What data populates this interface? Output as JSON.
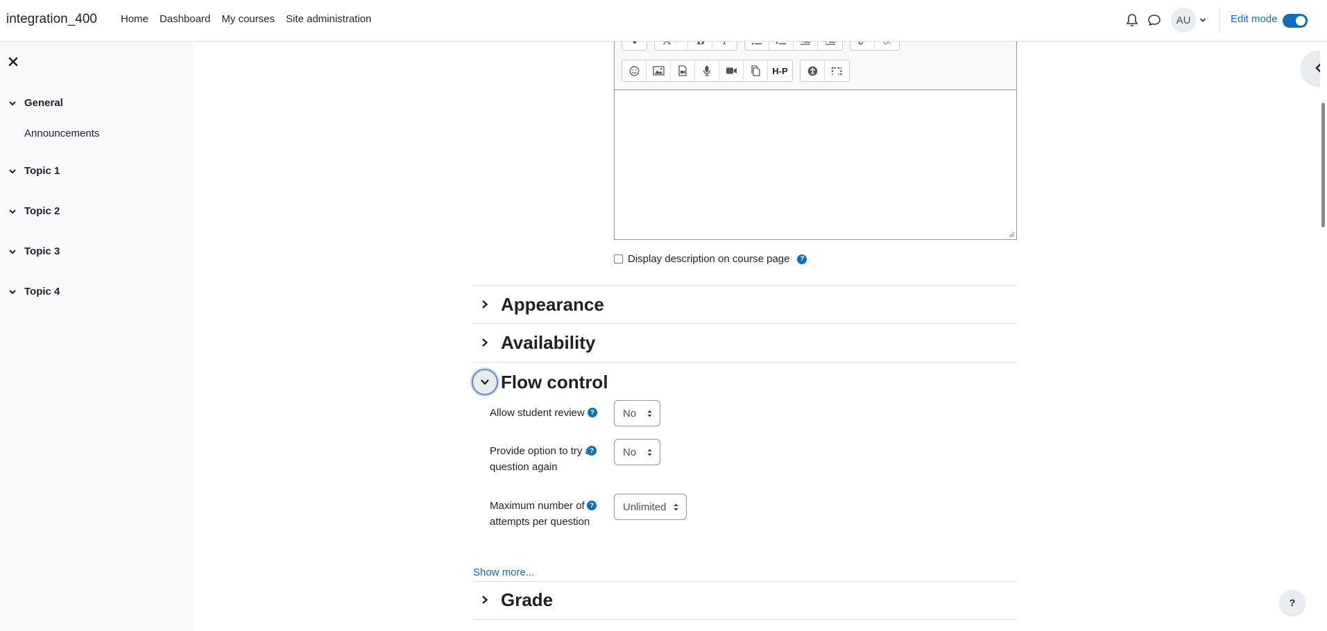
{
  "navbar": {
    "brand": "integration_400",
    "links": [
      "Home",
      "Dashboard",
      "My courses",
      "Site administration"
    ],
    "avatar_initials": "AU",
    "edit_mode_label": "Edit mode",
    "edit_mode_on": true
  },
  "drawer": {
    "sections": [
      {
        "label": "General",
        "items": [
          "Announcements"
        ]
      },
      {
        "label": "Topic 1",
        "items": []
      },
      {
        "label": "Topic 2",
        "items": []
      },
      {
        "label": "Topic 3",
        "items": []
      },
      {
        "label": "Topic 4",
        "items": []
      }
    ]
  },
  "editor": {
    "row2_h5p_label": "H-P"
  },
  "form": {
    "display_description_label": "Display description on course page",
    "display_description_checked": false,
    "sections": {
      "appearance": "Appearance",
      "availability": "Availability",
      "flow_control": "Flow control",
      "grade": "Grade"
    },
    "flow_control": {
      "allow_review_label": "Allow student review",
      "allow_review_value": "No",
      "try_again_label": "Provide option to try a question again",
      "try_again_value": "No",
      "max_attempts_label": "Maximum number of attempts per question",
      "max_attempts_value": "Unlimited"
    },
    "show_more": "Show more..."
  },
  "help_glyph": "?",
  "icons": [
    "bell-icon",
    "chat-icon",
    "chevron-down-icon",
    "close-icon",
    "chevron-left-icon",
    "chevron-right-icon",
    "help-icon"
  ]
}
